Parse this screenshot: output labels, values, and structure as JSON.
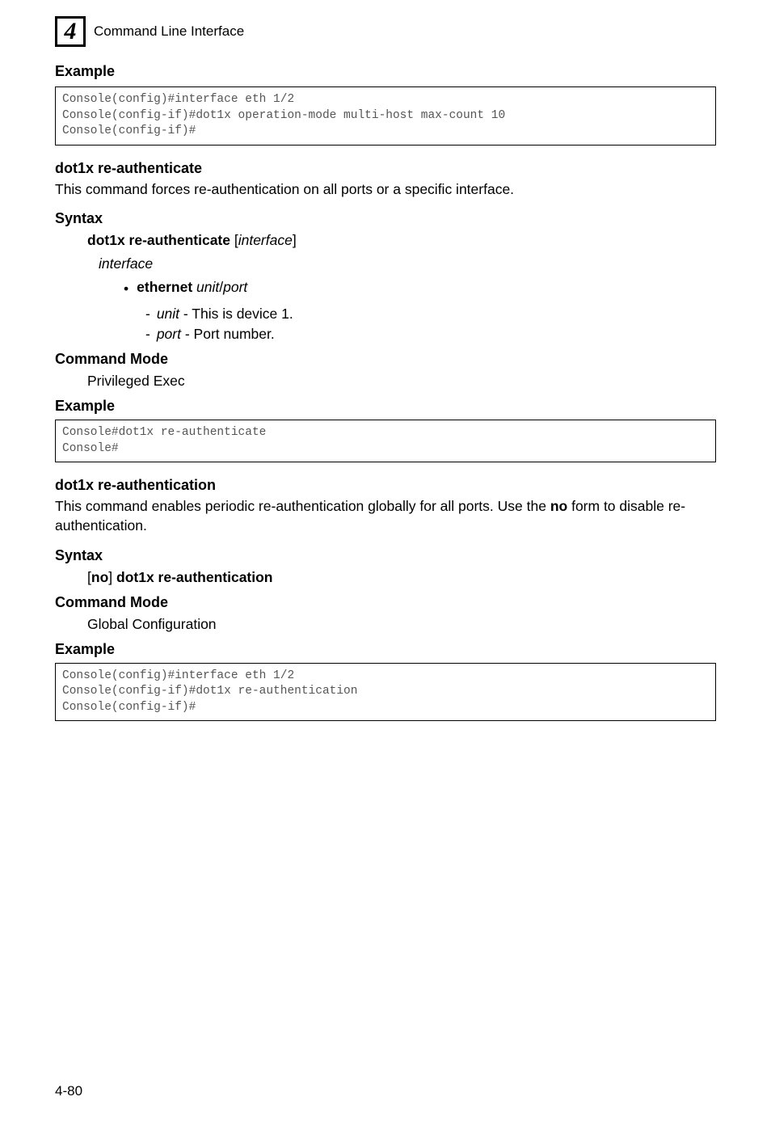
{
  "header": {
    "chapter_number": "4",
    "title": "Command Line Interface"
  },
  "example1": {
    "heading": "Example",
    "code": "Console(config)#interface eth 1/2\nConsole(config-if)#dot1x operation-mode multi-host max-count 10\nConsole(config-if)#"
  },
  "section1": {
    "title": "dot1x re-authenticate",
    "desc": "This command forces re-authentication on all ports or a specific interface.",
    "syntax_heading": "Syntax",
    "syntax_bold": "dot1x re-authenticate",
    "syntax_bracket_open": " [",
    "syntax_italic": "interface",
    "syntax_bracket_close": "]",
    "interface_label": "interface",
    "bullet_bold": "ethernet",
    "bullet_italic": " unit",
    "bullet_slash": "/",
    "bullet_italic2": "port",
    "sub1_italic": "unit ",
    "sub1_text": "- This is device 1.",
    "sub2_italic": "port",
    "sub2_text": " - Port number.",
    "cmd_mode_heading": "Command Mode",
    "cmd_mode_text": "Privileged Exec",
    "example_heading": "Example",
    "example_code": "Console#dot1x re-authenticate\nConsole#"
  },
  "section2": {
    "title": "dot1x re-authentication",
    "desc_pre": "This command enables periodic re-authentication globally for all ports. Use the ",
    "desc_bold": "no",
    "desc_post": " form to disable re-authentication.",
    "syntax_heading": "Syntax",
    "syntax_bracket_open": "[",
    "syntax_no": "no",
    "syntax_bracket_close": "] ",
    "syntax_cmd": "dot1x re-authentication",
    "cmd_mode_heading": "Command Mode",
    "cmd_mode_text": "Global Configuration",
    "example_heading": "Example",
    "example_code": "Console(config)#interface eth 1/2\nConsole(config-if)#dot1x re-authentication\nConsole(config-if)#"
  },
  "footer": {
    "page": "4-80"
  }
}
